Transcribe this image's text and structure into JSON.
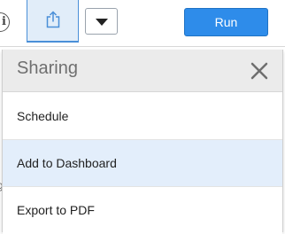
{
  "toolbar": {
    "info_icon_glyph": "i",
    "share_icon": "share-export-icon",
    "dropdown_icon": "caret-down-icon",
    "run_label": "Run",
    "accent_color": "#2e8cea"
  },
  "sharing_panel": {
    "title": "Sharing",
    "close_icon": "close-icon",
    "items": [
      {
        "label": "Schedule",
        "highlighted": false
      },
      {
        "label": "Add to Dashboard",
        "highlighted": true
      },
      {
        "label": "Export to PDF",
        "highlighted": false
      }
    ]
  }
}
